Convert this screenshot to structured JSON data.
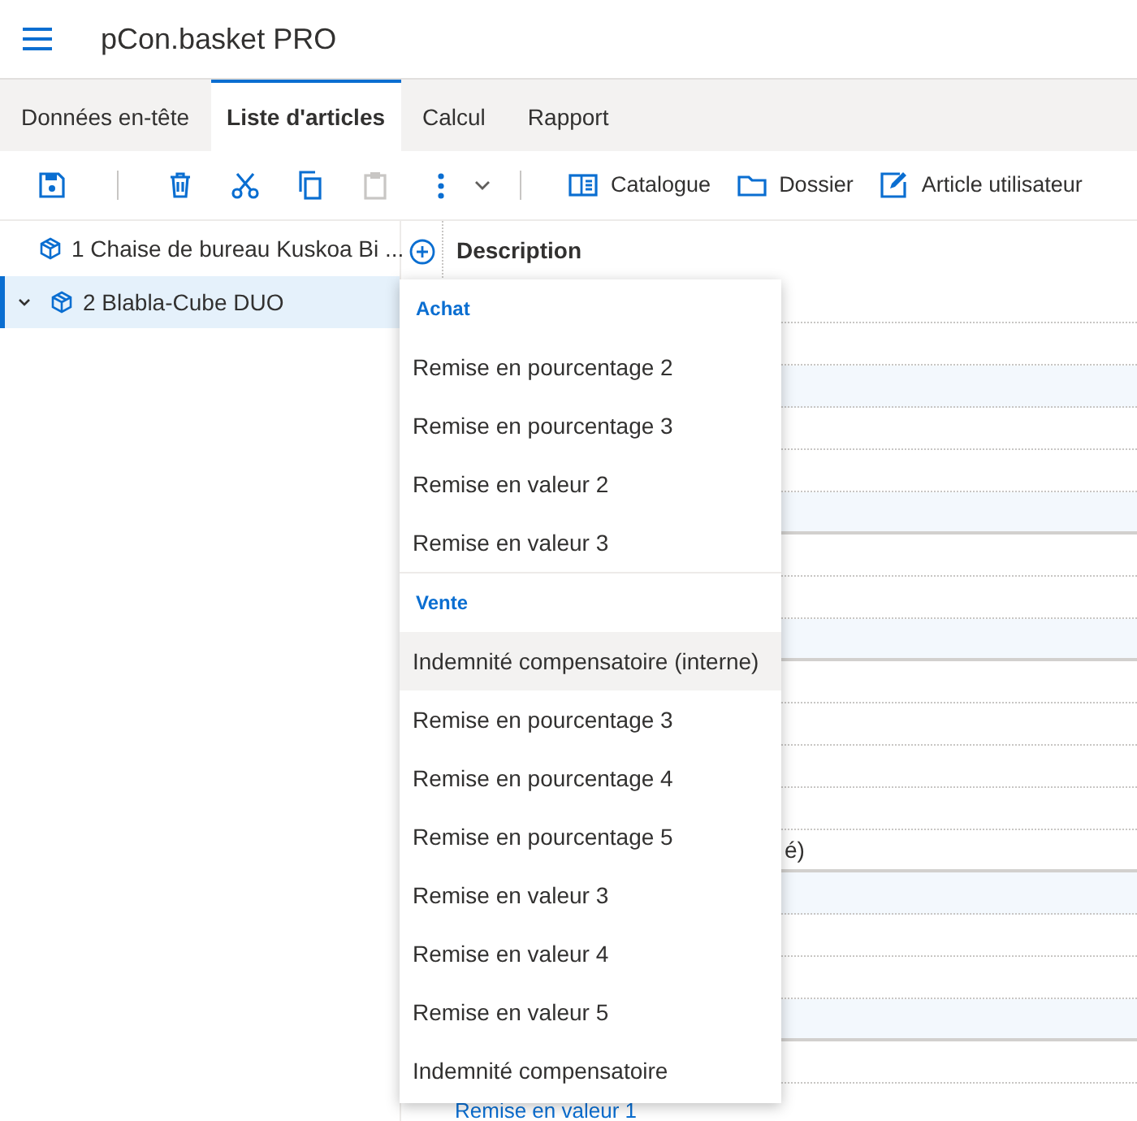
{
  "app": {
    "title": "pCon.basket PRO"
  },
  "tabs": [
    {
      "label": "Données en-tête",
      "selected": false
    },
    {
      "label": "Liste d'articles",
      "selected": true
    },
    {
      "label": "Calcul",
      "selected": false
    },
    {
      "label": "Rapport",
      "selected": false
    }
  ],
  "toolbar": [
    {
      "kind": "save",
      "disabled": false
    },
    {
      "kind": "separator"
    },
    {
      "kind": "delete",
      "disabled": false
    },
    {
      "kind": "cut",
      "disabled": false
    },
    {
      "kind": "copy",
      "disabled": false
    },
    {
      "kind": "paste",
      "disabled": true
    },
    {
      "kind": "more",
      "disabled": false
    },
    {
      "kind": "dropdown",
      "disabled": false
    },
    {
      "kind": "separator"
    },
    {
      "kind": "catalogue",
      "label": "Catalogue",
      "disabled": false
    },
    {
      "kind": "folder",
      "label": "Dossier",
      "disabled": false
    },
    {
      "kind": "edit",
      "label": "Article utilisateur",
      "disabled": false
    }
  ],
  "tree": [
    {
      "label": "1 Chaise de bureau Kuskoa Bi ...",
      "selected": false
    },
    {
      "label": "2 Blabla-Cube DUO",
      "selected": true,
      "expanded": true
    }
  ],
  "table": {
    "columns": [
      "Description"
    ],
    "visible_cells": [
      {
        "text": "é)",
        "kind": "text"
      },
      {
        "text": "Remise en valeur 1",
        "kind": "link"
      }
    ]
  },
  "menu": {
    "groups": [
      {
        "title": "Achat",
        "items": [
          {
            "label": "Remise en pourcentage 2",
            "highlighted": false
          },
          {
            "label": "Remise en pourcentage 3",
            "highlighted": false
          },
          {
            "label": "Remise en valeur 2",
            "highlighted": false
          },
          {
            "label": "Remise en valeur 3",
            "highlighted": false
          }
        ]
      },
      {
        "title": "Vente",
        "items": [
          {
            "label": "Indemnité compensatoire (interne)",
            "highlighted": true
          },
          {
            "label": "Remise en pourcentage 3",
            "highlighted": false
          },
          {
            "label": "Remise en pourcentage 4",
            "highlighted": false
          },
          {
            "label": "Remise en pourcentage 5",
            "highlighted": false
          },
          {
            "label": "Remise en valeur 3",
            "highlighted": false
          },
          {
            "label": "Remise en valeur 4",
            "highlighted": false
          },
          {
            "label": "Remise en valeur 5",
            "highlighted": false
          },
          {
            "label": "Indemnité compensatoire",
            "highlighted": false
          }
        ]
      }
    ]
  }
}
